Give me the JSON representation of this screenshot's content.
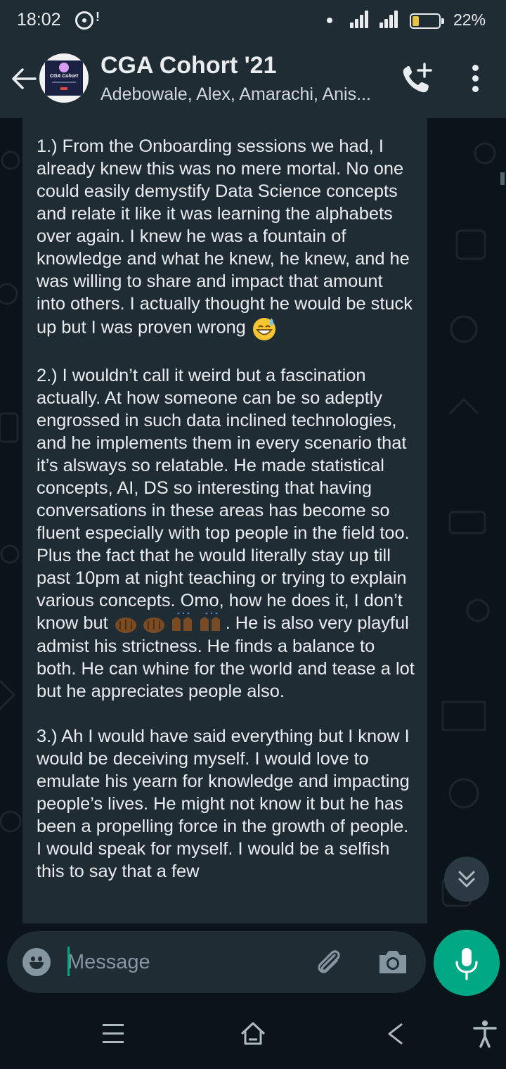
{
  "status_bar": {
    "time": "18:02",
    "notification": "!",
    "battery_percent_text": "22%",
    "battery_level": 0.22
  },
  "header": {
    "title": "CGA Cohort '21",
    "subtitle": "Adebowale, Alex, Amarachi, Anis...",
    "avatar_text": "CGA Cohort"
  },
  "message": {
    "p1": "1.) From the Onboarding sessions we had, I already knew this was no mere mortal. No one could easily demystify Data Science concepts and relate it like it was learning the alphabets over again. I knew he was a fountain of knowledge and what he knew, he knew, and he was willing to share and impact that amount into others. I actually thought he would be stuck up but I was proven wrong",
    "p1_emoji": "grinning-sweat",
    "p2_before": "2.) I wouldn’t call it weird but a fascination actually. At how someone can be so adeptly engrossed in such data inclined technologies, and he implements them in every scenario that it’s alsways so relatable. He made statistical concepts, AI, DS so interesting that having conversations in these areas has become so fluent especially with top people in the field too. Plus the fact that he would literally stay up till past 10pm at night teaching or trying to explain various concepts. Omo, how he does it, I don’t know but ",
    "p2_emojis": [
      "clapping-hands",
      "clapping-hands",
      "raising-hands",
      "raising-hands"
    ],
    "p2_after": ". He is also very playful admist his strictness. He finds a balance to both. He can whine for the world and tease a lot but he appreciates people also.",
    "p3": "3.) Ah I would have said everything but I know I would be deceiving myself. I would love to emulate his yearn for knowledge and impacting people’s lives. He might not know it but he has been a propelling force in the growth of people. I would speak for myself. I would be a selfish this to say that a few"
  },
  "composer": {
    "placeholder": "Message"
  },
  "colors": {
    "header_bg": "#1f2c34",
    "chat_bg": "#0b141a",
    "bubble_bg": "#202c33",
    "accent": "#00a884",
    "text": "#e9edef"
  }
}
